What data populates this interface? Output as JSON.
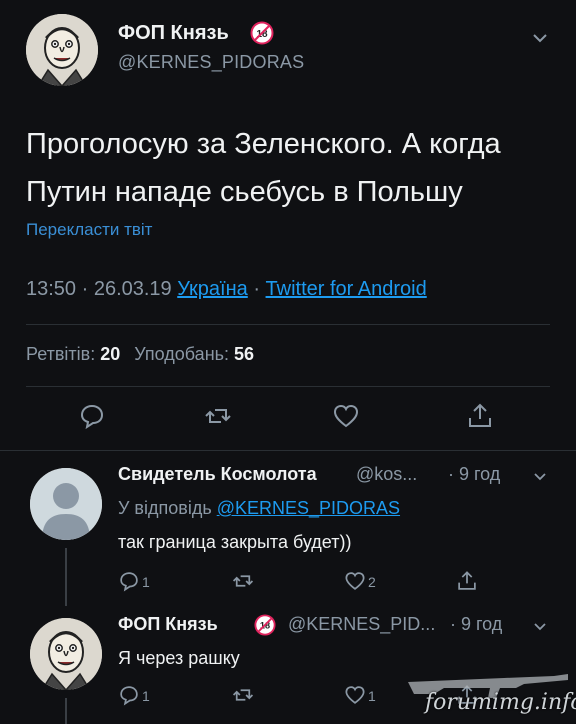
{
  "main_tweet": {
    "name": "ФОП Князь",
    "badge": "18",
    "handle": "@KERNES_PIDORAS",
    "text": "Проголосую за Зеленского. А когда Путин нападе сьебусь в Польшу",
    "translate_label": "Перекласти твіт",
    "time": "13:50 · 26.03.19 ",
    "location": "Україна",
    "separator": " · ",
    "source": "Twitter for Android",
    "retweets_label": "Ретвітів: ",
    "retweets": "20",
    "likes_label": "Уподобань: ",
    "likes": "56"
  },
  "replies": [
    {
      "name": "Свидетель Космолота",
      "handle": "@kos...",
      "time": " · 9 год",
      "reply_to_label": "У відповідь ",
      "reply_to": "@KERNES_PIDORAS",
      "text": "так граница закрыта будет))",
      "reply_count": "1",
      "like_count": "2"
    },
    {
      "name": "ФОП Князь",
      "badge": "18",
      "handle": "@KERNES_PID...",
      "time": " · 9 год",
      "text": "Я через рашку",
      "reply_count": "1",
      "like_count": "1"
    }
  ],
  "watermark": "forumimg.info",
  "colors": {
    "background": "#0f1013",
    "link": "#1d9bf0",
    "secondary": "#8b98a5",
    "badge": "#e0245e"
  }
}
